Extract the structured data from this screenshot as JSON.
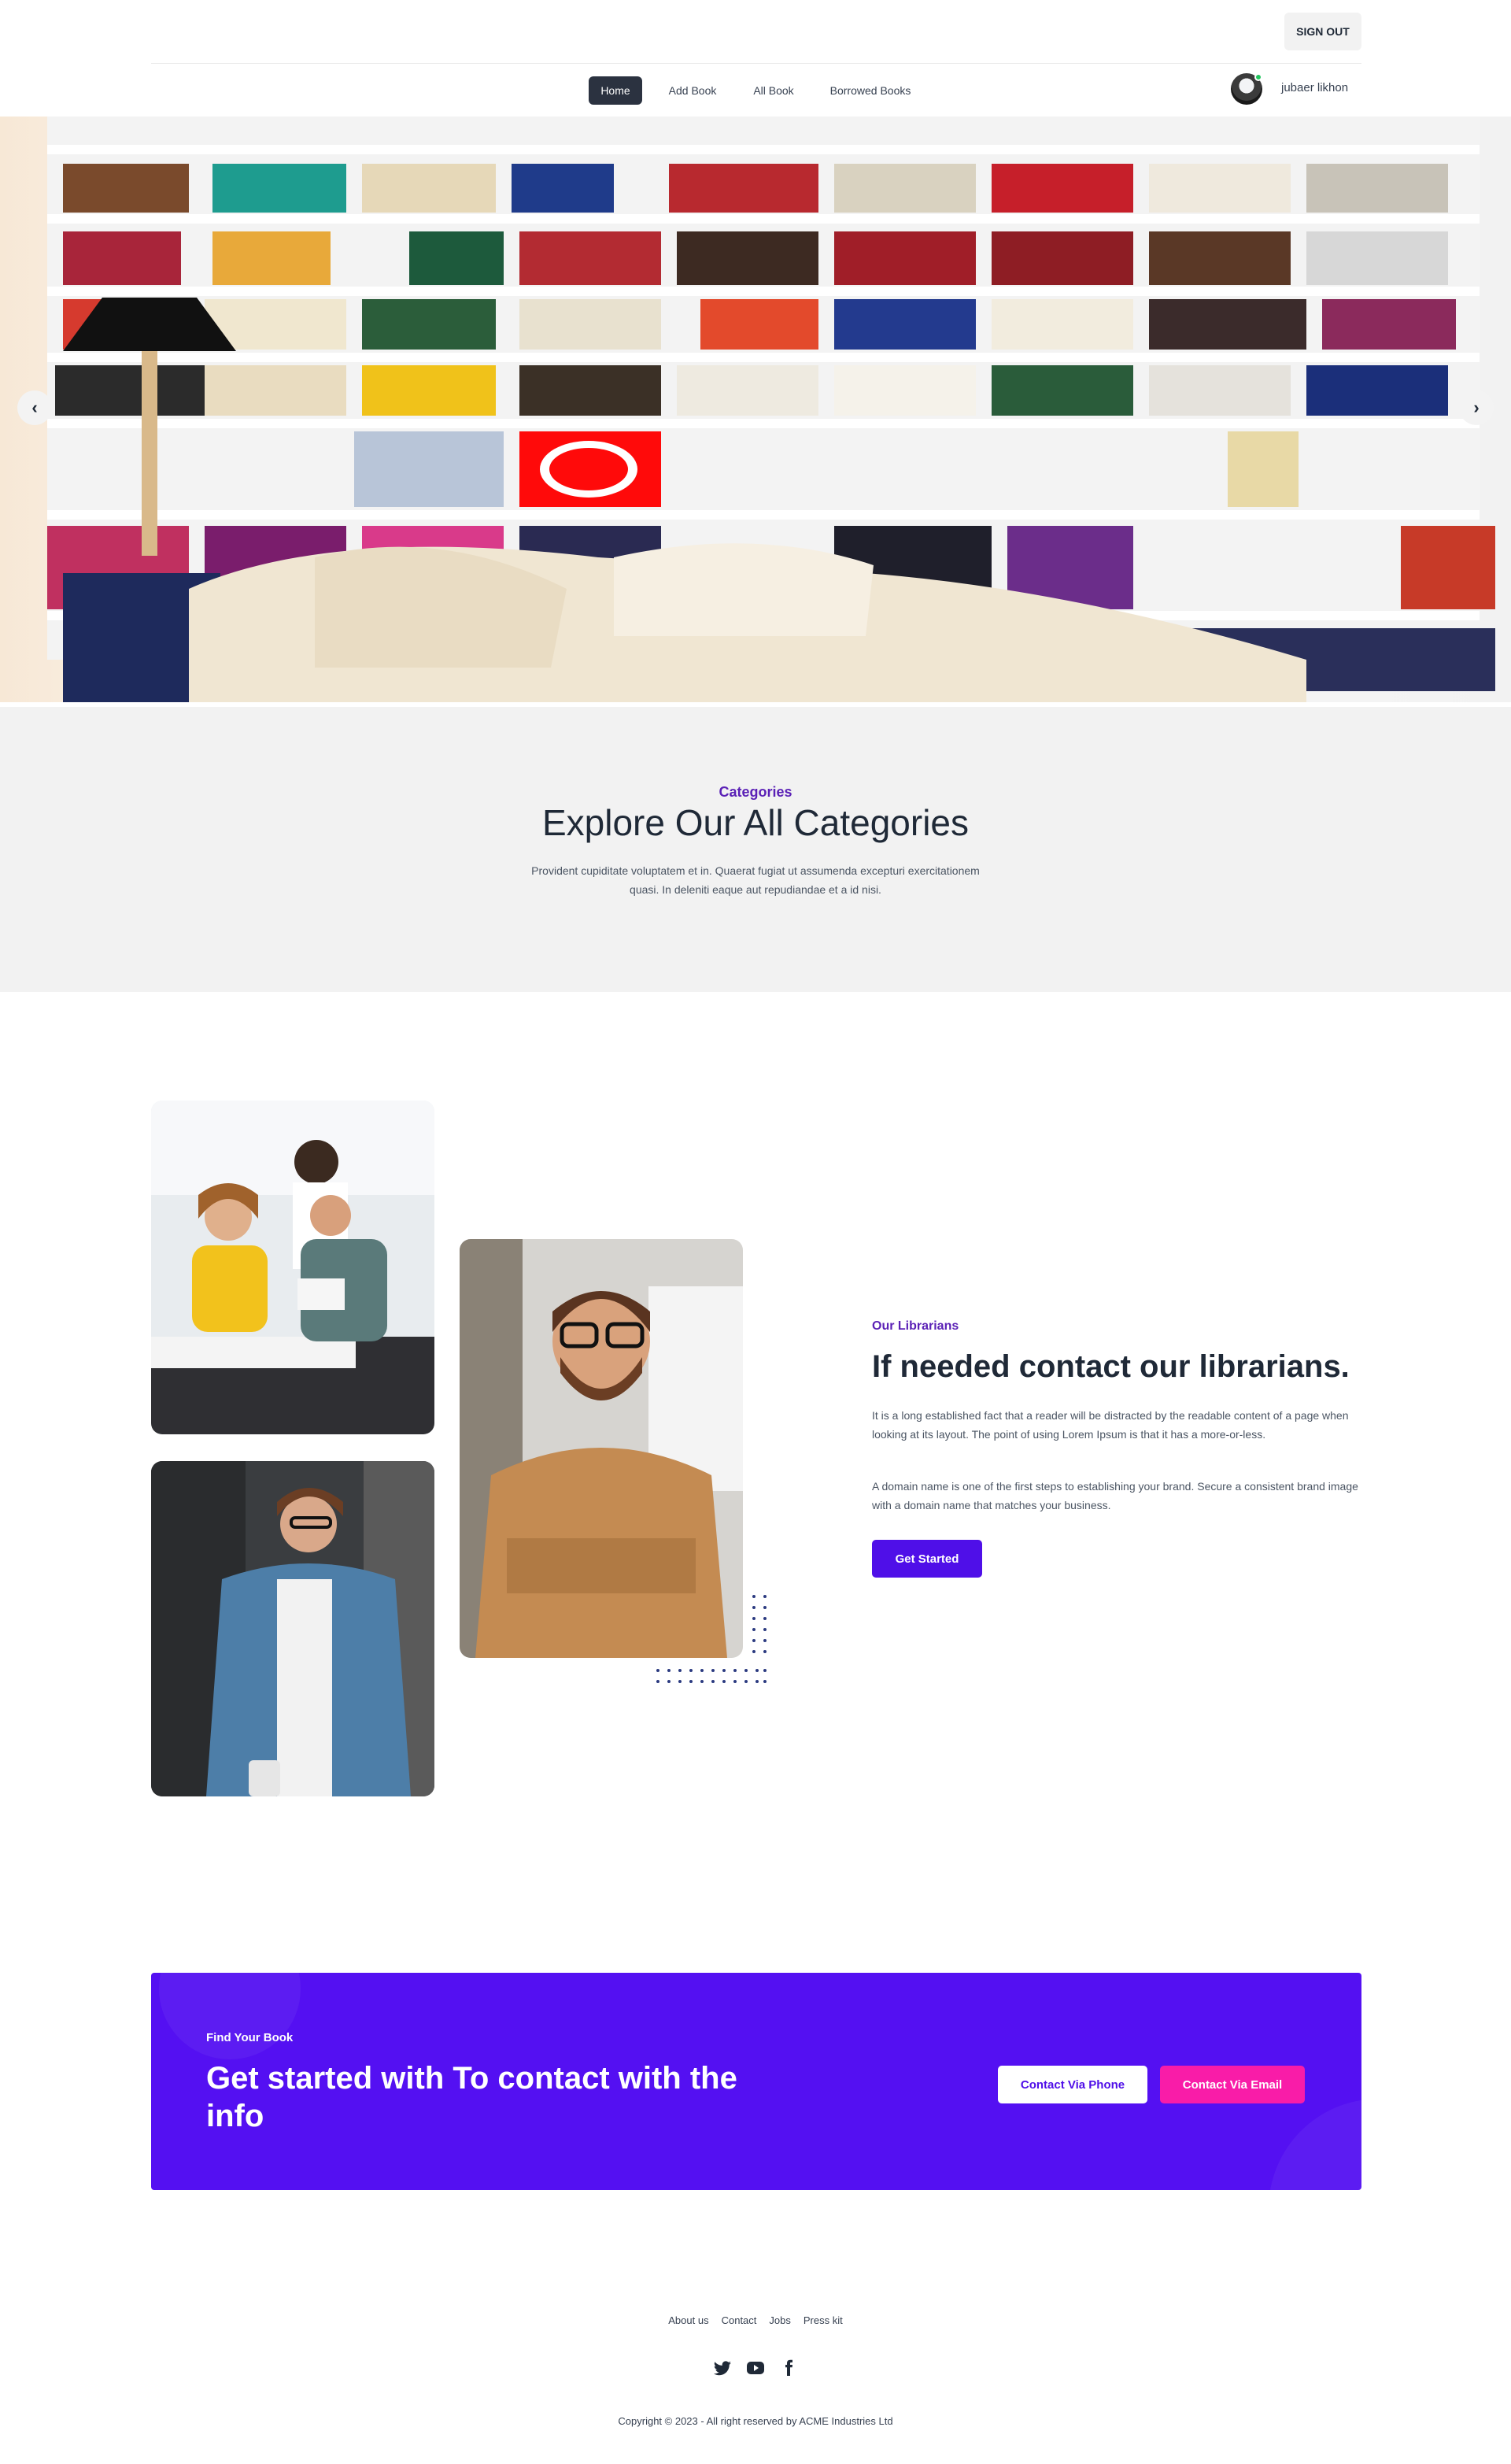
{
  "header": {
    "signout_label": "SIGN OUT"
  },
  "nav": {
    "items": [
      {
        "label": "Home",
        "active": true
      },
      {
        "label": "Add Book",
        "active": false
      },
      {
        "label": "All Book",
        "active": false
      },
      {
        "label": "Borrowed Books",
        "active": false
      }
    ],
    "username": "jubaer likhon"
  },
  "hero": {
    "prev_icon": "‹",
    "next_icon": "›"
  },
  "categories": {
    "eyebrow": "Categories",
    "title": "Explore Our All Categories",
    "description": "Provident cupiditate voluptatem et in. Quaerat fugiat ut assumenda excepturi exercitationem quasi. In deleniti eaque aut repudiandae et a id nisi."
  },
  "librarians": {
    "eyebrow": "Our Librarians",
    "title": "If needed contact our librarians.",
    "paragraph1": "It is a long established fact that a reader will be distracted by the readable content of a page when looking at its layout. The point of using Lorem Ipsum is that it has a more-or-less.",
    "paragraph2": "A domain name is one of the first steps to establishing your brand. Secure a consistent brand image with a domain name that matches your business.",
    "button_label": "Get Started"
  },
  "cta": {
    "eyebrow": "Find Your Book",
    "title": "Get started with To contact with the info",
    "phone_label": "Contact Via Phone",
    "email_label": "Contact Via Email"
  },
  "footer": {
    "links": [
      "About us",
      "Contact",
      "Jobs",
      "Press kit"
    ],
    "socials": [
      "twitter-icon",
      "youtube-icon",
      "facebook-icon"
    ],
    "copyright": "Copyright © 2023 - All right reserved by ACME Industries Ltd"
  },
  "colors": {
    "primary": "#5410f2",
    "accent_pink": "#f91ca8",
    "nav_active": "#2b3240",
    "eyebrow_purple": "#5b21b6"
  }
}
